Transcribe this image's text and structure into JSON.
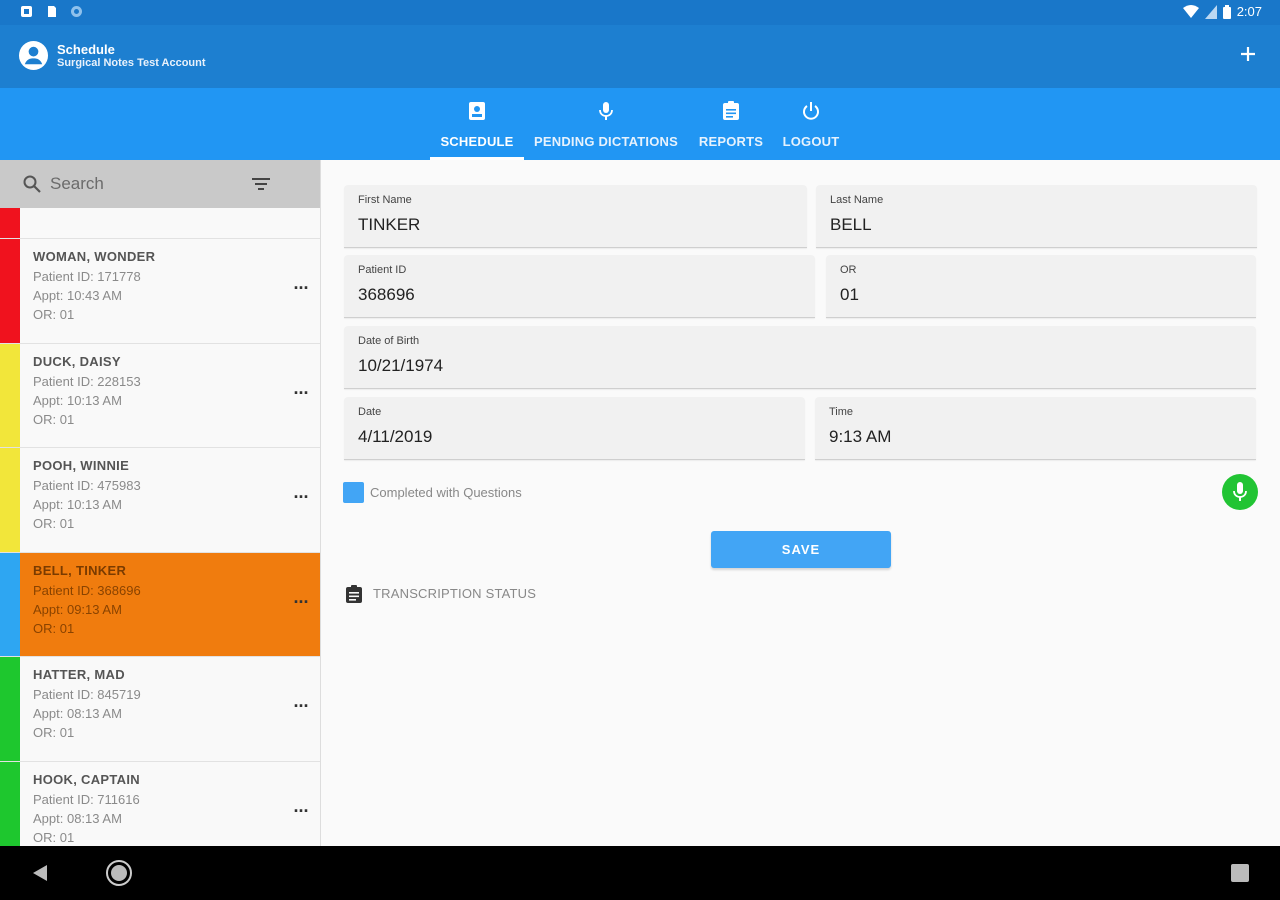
{
  "status_bar": {
    "time": "2:07"
  },
  "app_bar": {
    "title": "Schedule",
    "subtitle": "Surgical Notes Test Account"
  },
  "tabs": [
    {
      "label": "SCHEDULE",
      "icon": "schedule-icon",
      "active": true
    },
    {
      "label": "PENDING DICTATIONS",
      "icon": "mic-icon",
      "active": false
    },
    {
      "label": "REPORTS",
      "icon": "clipboard-icon",
      "active": false
    },
    {
      "label": "LOGOUT",
      "icon": "power-icon",
      "active": false
    }
  ],
  "search": {
    "placeholder": "Search"
  },
  "patients": [
    {
      "name": "WOMAN, WONDER",
      "patient_id": "Patient ID: 171778",
      "appt": "Appt: 10:43 AM",
      "or": "OR: 01",
      "color": "#f0121e"
    },
    {
      "name": "DUCK, DAISY",
      "patient_id": "Patient ID: 228153",
      "appt": "Appt: 10:13 AM",
      "or": "OR: 01",
      "color": "#f2e63a"
    },
    {
      "name": "POOH, WINNIE",
      "patient_id": "Patient ID: 475983",
      "appt": "Appt: 10:13 AM",
      "or": "OR: 01",
      "color": "#f2e63a"
    },
    {
      "name": "BELL, TINKER",
      "patient_id": "Patient ID: 368696",
      "appt": "Appt: 09:13 AM",
      "or": "OR: 01",
      "color": "#2ea6f2",
      "selected": true
    },
    {
      "name": "HATTER, MAD",
      "patient_id": "Patient ID: 845719",
      "appt": "Appt: 08:13 AM",
      "or": "OR: 01",
      "color": "#1ec72e"
    },
    {
      "name": "HOOK, CAPTAIN",
      "patient_id": "Patient ID: 711616",
      "appt": "Appt: 08:13 AM",
      "or": "OR: 01",
      "color": "#1ec72e"
    }
  ],
  "form": {
    "first_name": {
      "label": "First Name",
      "value": "TINKER"
    },
    "last_name": {
      "label": "Last Name",
      "value": "BELL"
    },
    "patient_id": {
      "label": "Patient ID",
      "value": "368696"
    },
    "or": {
      "label": "OR",
      "value": "01"
    },
    "dob": {
      "label": "Date of Birth",
      "value": "10/21/1974"
    },
    "date": {
      "label": "Date",
      "value": "4/11/2019"
    },
    "time": {
      "label": "Time",
      "value": "9:13 AM"
    },
    "checkbox_label": "Completed with Questions",
    "checkbox_checked": true,
    "save_label": "SAVE",
    "transcription_label": "TRANSCRIPTION STATUS"
  },
  "colors": {
    "status_bar": "#1977c9",
    "app_bar": "#1d7fd0",
    "tab_bar": "#2196f3",
    "selected_row": "#f07c0e",
    "accent": "#42a5f5",
    "mic_button": "#21c433"
  }
}
